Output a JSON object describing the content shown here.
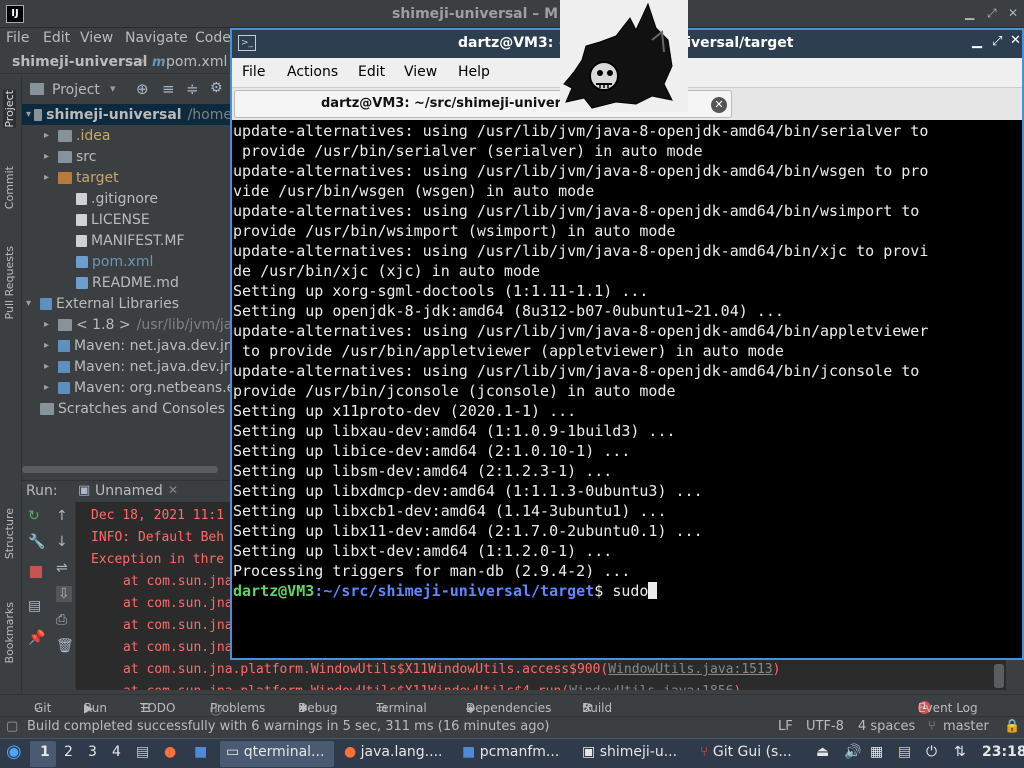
{
  "ide": {
    "title": "shimeji-universal – M",
    "menu": [
      "File",
      "Edit",
      "View",
      "Navigate",
      "Code"
    ],
    "breadcrumb_project": "shimeji-universal",
    "breadcrumb_file": "pom.xml",
    "left_tabs": [
      "Project",
      "Commit",
      "Pull Requests",
      "Structure",
      "Bookmarks"
    ],
    "project_label": "Project",
    "tree": [
      {
        "label": "shimeji-universal",
        "suffix": "/home",
        "indent": 0,
        "arrow": "▾",
        "icon": "folder-blue",
        "selected": true
      },
      {
        "label": ".idea",
        "indent": 1,
        "arrow": "▸",
        "icon": "folder-blue",
        "color": "#c9a86a"
      },
      {
        "label": "src",
        "indent": 1,
        "arrow": "▸",
        "icon": "folder-blue"
      },
      {
        "label": "target",
        "indent": 1,
        "arrow": "▸",
        "icon": "folder-orange",
        "color": "#c9a86a"
      },
      {
        "label": ".gitignore",
        "indent": 2,
        "arrow": "",
        "icon": "file-txt"
      },
      {
        "label": "LICENSE",
        "indent": 2,
        "arrow": "",
        "icon": "file-txt"
      },
      {
        "label": "MANIFEST.MF",
        "indent": 2,
        "arrow": "",
        "icon": "file-txt"
      },
      {
        "label": "pom.xml",
        "indent": 2,
        "arrow": "",
        "icon": "file-m",
        "color": "#6897bb"
      },
      {
        "label": "README.md",
        "indent": 2,
        "arrow": "",
        "icon": "file-m"
      },
      {
        "label": "External Libraries",
        "indent": 0,
        "arrow": "▾",
        "icon": "lib"
      },
      {
        "label": "< 1.8 >",
        "suffix": "/usr/lib/jvm/ja",
        "indent": 1,
        "arrow": "▸",
        "icon": "folder-blue"
      },
      {
        "label": "Maven: net.java.dev.jn",
        "indent": 1,
        "arrow": "▸",
        "icon": "lib"
      },
      {
        "label": "Maven: net.java.dev.jn",
        "indent": 1,
        "arrow": "▸",
        "icon": "lib"
      },
      {
        "label": "Maven: org.netbeans.e",
        "indent": 1,
        "arrow": "▸",
        "icon": "lib"
      },
      {
        "label": "Scratches and Consoles",
        "indent": 0,
        "arrow": "",
        "icon": "folder-blue"
      }
    ],
    "run_label": "Run:",
    "run_config": "Unnamed",
    "console_lines": [
      {
        "text": "Dec 18, 2021 11:1",
        "indent": 0
      },
      {
        "text": "INFO: Default Beh",
        "indent": 0
      },
      {
        "text": "Exception in thre",
        "indent": 0
      },
      {
        "text": "at com.sun.jna",
        "indent": 1
      },
      {
        "text": "at com.sun.jna",
        "indent": 1
      },
      {
        "text": "at com.sun.jna",
        "indent": 1
      },
      {
        "text": "at com.sun.jna",
        "indent": 1
      },
      {
        "text": "at com.sun.jna.platform.WindowUtils$X11WindowUtils.access$900(",
        "indent": 1,
        "link": "WindowUtils.java:1513",
        "tail": ")"
      },
      {
        "text": "at com.sun.jna.platform.WindowUtils$X11WindowUtils$4.run(",
        "indent": 1,
        "link": "WindowUtils.java:1856",
        "tail": ")"
      }
    ],
    "bottom_tabs": [
      "Git",
      "Run",
      "TODO",
      "Problems",
      "Debug",
      "Terminal",
      "Dependencies",
      "Build"
    ],
    "event_log": "Event Log",
    "event_count": "1",
    "status_message": "Build completed successfully with 6 warnings in 5 sec, 311 ms (16 minutes ago)",
    "status_right": [
      "LF",
      "UTF-8",
      "4 spaces",
      "master"
    ]
  },
  "terminal": {
    "title": "dartz@VM3: ~/src/shimeji-universal/target",
    "menu": [
      "File",
      "Actions",
      "Edit",
      "View",
      "Help"
    ],
    "tab_title": "dartz@VM3: ~/src/shimeji-universal/target",
    "lines": [
      "update-alternatives: using /usr/lib/jvm/java-8-openjdk-amd64/bin/serialver to",
      " provide /usr/bin/serialver (serialver) in auto mode",
      "update-alternatives: using /usr/lib/jvm/java-8-openjdk-amd64/bin/wsgen to pro",
      "vide /usr/bin/wsgen (wsgen) in auto mode",
      "update-alternatives: using /usr/lib/jvm/java-8-openjdk-amd64/bin/wsimport to",
      "provide /usr/bin/wsimport (wsimport) in auto mode",
      "update-alternatives: using /usr/lib/jvm/java-8-openjdk-amd64/bin/xjc to provi",
      "de /usr/bin/xjc (xjc) in auto mode",
      "Setting up xorg-sgml-doctools (1:1.11-1.1) ...",
      "Setting up openjdk-8-jdk:amd64 (8u312-b07-0ubuntu1~21.04) ...",
      "update-alternatives: using /usr/lib/jvm/java-8-openjdk-amd64/bin/appletviewer",
      " to provide /usr/bin/appletviewer (appletviewer) in auto mode",
      "update-alternatives: using /usr/lib/jvm/java-8-openjdk-amd64/bin/jconsole to",
      "provide /usr/bin/jconsole (jconsole) in auto mode",
      "Setting up x11proto-dev (2020.1-1) ...",
      "Setting up libxau-dev:amd64 (1:1.0.9-1build3) ...",
      "Setting up libice-dev:amd64 (2:1.0.10-1) ...",
      "Setting up libsm-dev:amd64 (2:1.2.3-1) ...",
      "Setting up libxdmcp-dev:amd64 (1:1.1.3-0ubuntu3) ...",
      "Setting up libxcb1-dev:amd64 (1.14-3ubuntu1) ...",
      "Setting up libx11-dev:amd64 (2:1.7.0-2ubuntu0.1) ...",
      "Setting up libxt-dev:amd64 (1:1.2.0-1) ...",
      "Processing triggers for man-db (2.9.4-2) ..."
    ],
    "prompt_user": "dartz@VM3",
    "prompt_path": ":~/src/shimeji-universal/target",
    "prompt_symbol": "$ ",
    "command": "sudo"
  },
  "taskbar": {
    "workspaces": [
      "1",
      "2",
      "3",
      "4"
    ],
    "apps": [
      "qterminal...",
      "java.lang....",
      "pcmanfm...",
      "shimeji-u...",
      "Git Gui (s..."
    ],
    "clock": "23:18"
  }
}
